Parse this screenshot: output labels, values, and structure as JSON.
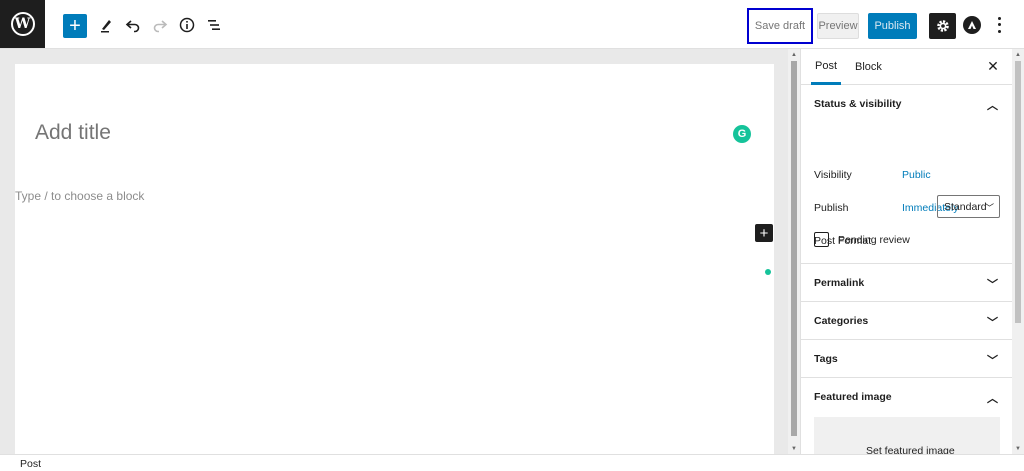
{
  "toolbar": {
    "logo_icon": "wordpress-logo",
    "add_block_icon": "plus",
    "tools_icon": "pencil",
    "undo_icon": "undo-arrow",
    "redo_icon": "redo-arrow",
    "details_icon": "info-circle",
    "outline_icon": "list-view",
    "save_draft_label": "Save draft",
    "preview_label": "Preview",
    "publish_label": "Publish",
    "settings_icon": "gear",
    "astra_icon": "astra-logo",
    "more_icon": "vertical-ellipsis"
  },
  "editor": {
    "title_placeholder": "Add title",
    "block_placeholder": "Type / to choose a block",
    "grammarly_icon": "grammarly",
    "inserter_icon": "plus"
  },
  "sidebar": {
    "tabs": [
      {
        "label": "Post",
        "active": true
      },
      {
        "label": "Block",
        "active": false
      }
    ],
    "close_icon": "close-x",
    "status_visibility": {
      "title": "Status & visibility",
      "visibility_label": "Visibility",
      "visibility_value": "Public",
      "publish_label": "Publish",
      "publish_value": "Immediately",
      "post_format_label": "Post Format",
      "post_format_value": "Standard",
      "pending_review_label": "Pending review",
      "pending_review_checked": false
    },
    "panels": [
      {
        "title": "Permalink",
        "open": false
      },
      {
        "title": "Categories",
        "open": false
      },
      {
        "title": "Tags",
        "open": false
      },
      {
        "title": "Featured image",
        "open": true
      }
    ],
    "featured_image_button": "Set featured image"
  },
  "footer": {
    "breadcrumb": "Post"
  },
  "colors": {
    "accent": "#007cba",
    "dark": "#1e1e1e",
    "grammarly": "#15c39a",
    "highlight_box": "#0000d0"
  }
}
